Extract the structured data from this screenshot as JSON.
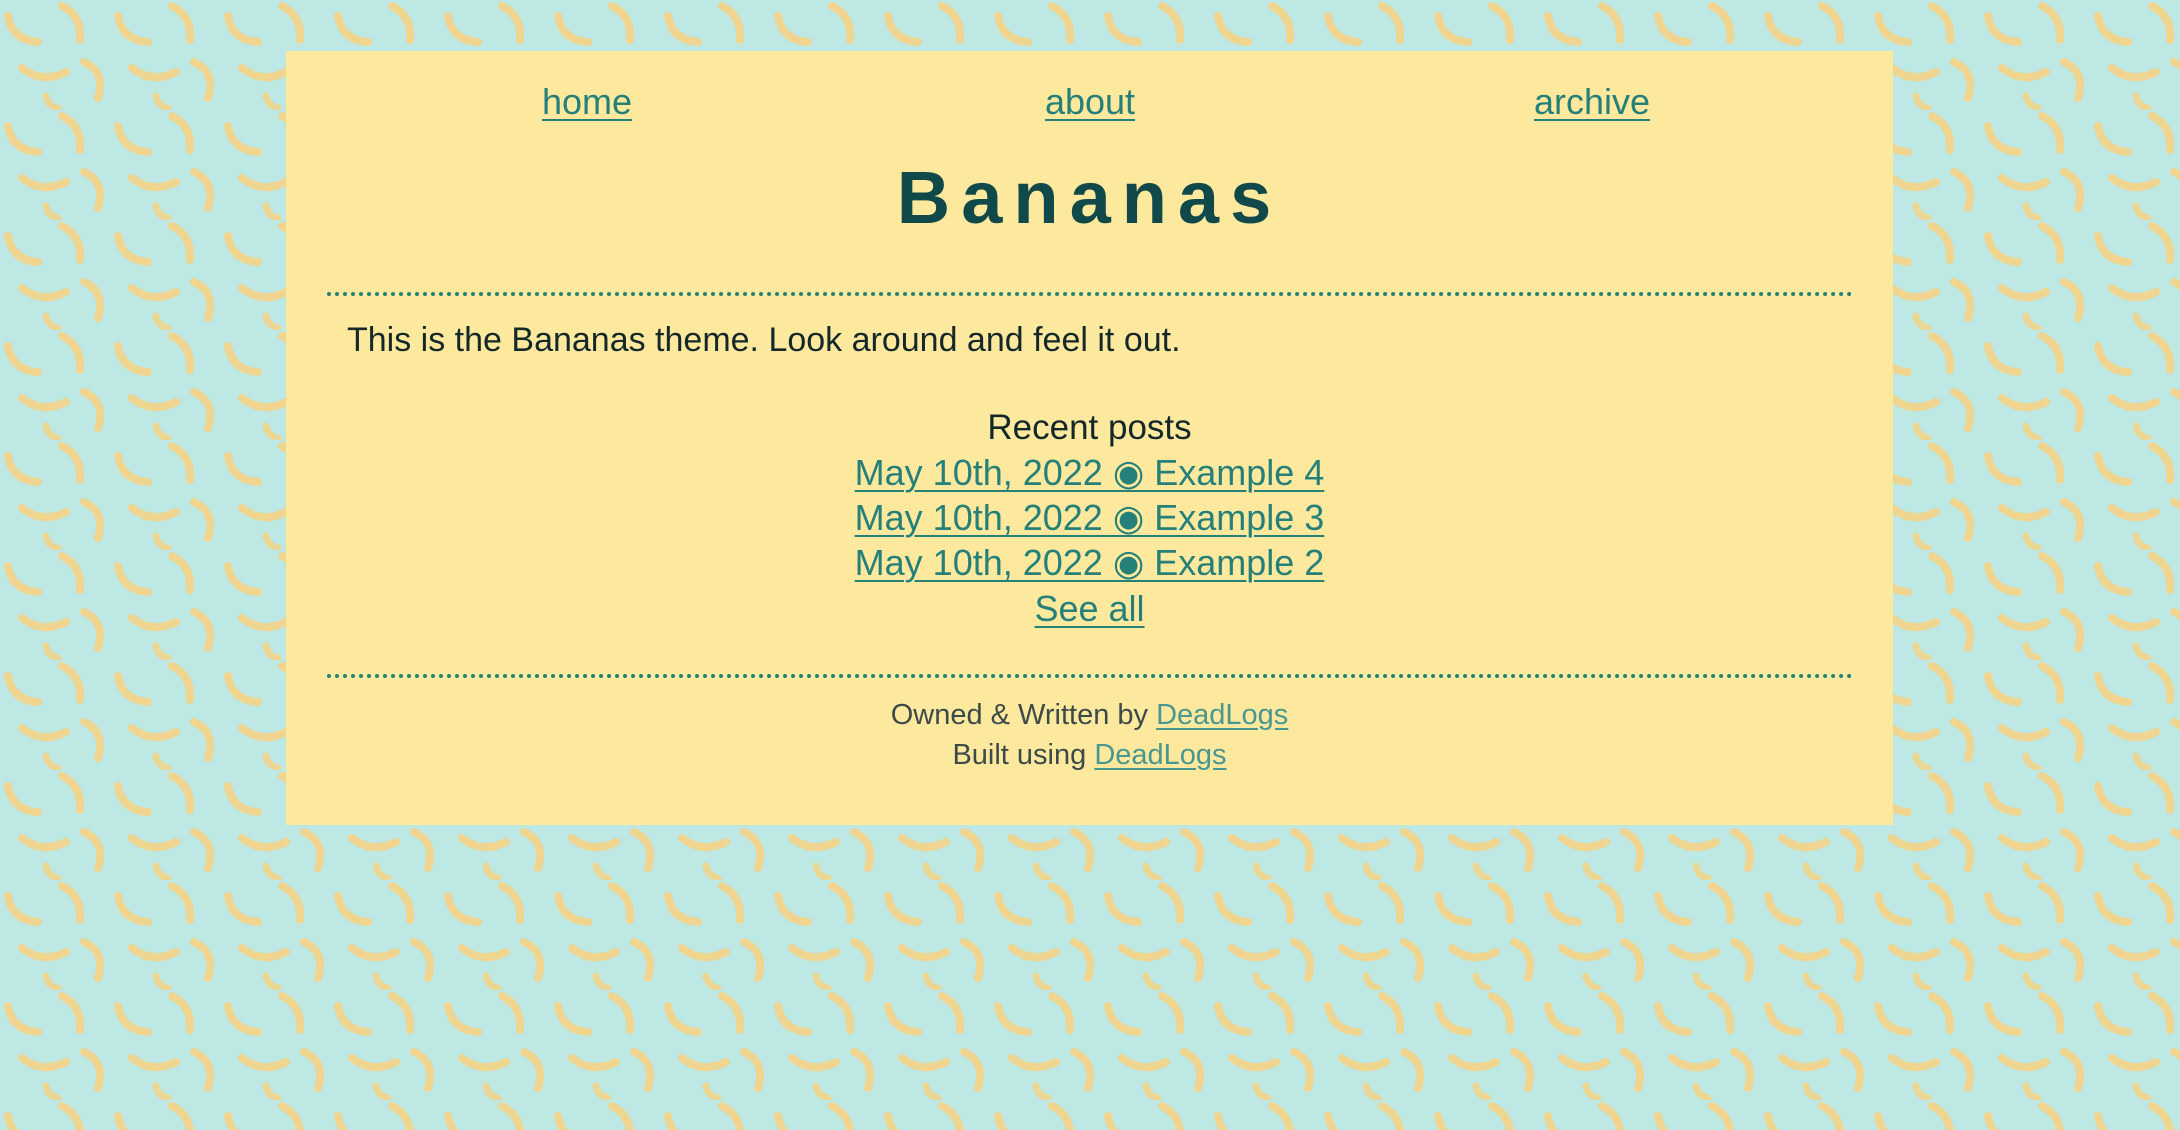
{
  "colors": {
    "background": "#bde8e4",
    "panel": "#fde99e",
    "link": "#25807a",
    "title": "#11494a",
    "text": "#14282a",
    "banana": "#f3d58a"
  },
  "nav": {
    "items": [
      {
        "label": "home"
      },
      {
        "label": "about"
      },
      {
        "label": "archive"
      }
    ]
  },
  "site": {
    "title": "Bananas"
  },
  "intro": {
    "text": "This is the Bananas theme. Look around and feel it out."
  },
  "recent_posts": {
    "heading": "Recent posts",
    "posts": [
      {
        "label": "May 10th, 2022 ◉ Example 4"
      },
      {
        "label": "May 10th, 2022 ◉ Example 3"
      },
      {
        "label": "May 10th, 2022 ◉ Example 2"
      }
    ],
    "see_all_label": "See all"
  },
  "footer": {
    "owned_prefix": "Owned & Written by ",
    "owned_link": "DeadLogs",
    "built_prefix": "Built using ",
    "built_link": "DeadLogs"
  }
}
